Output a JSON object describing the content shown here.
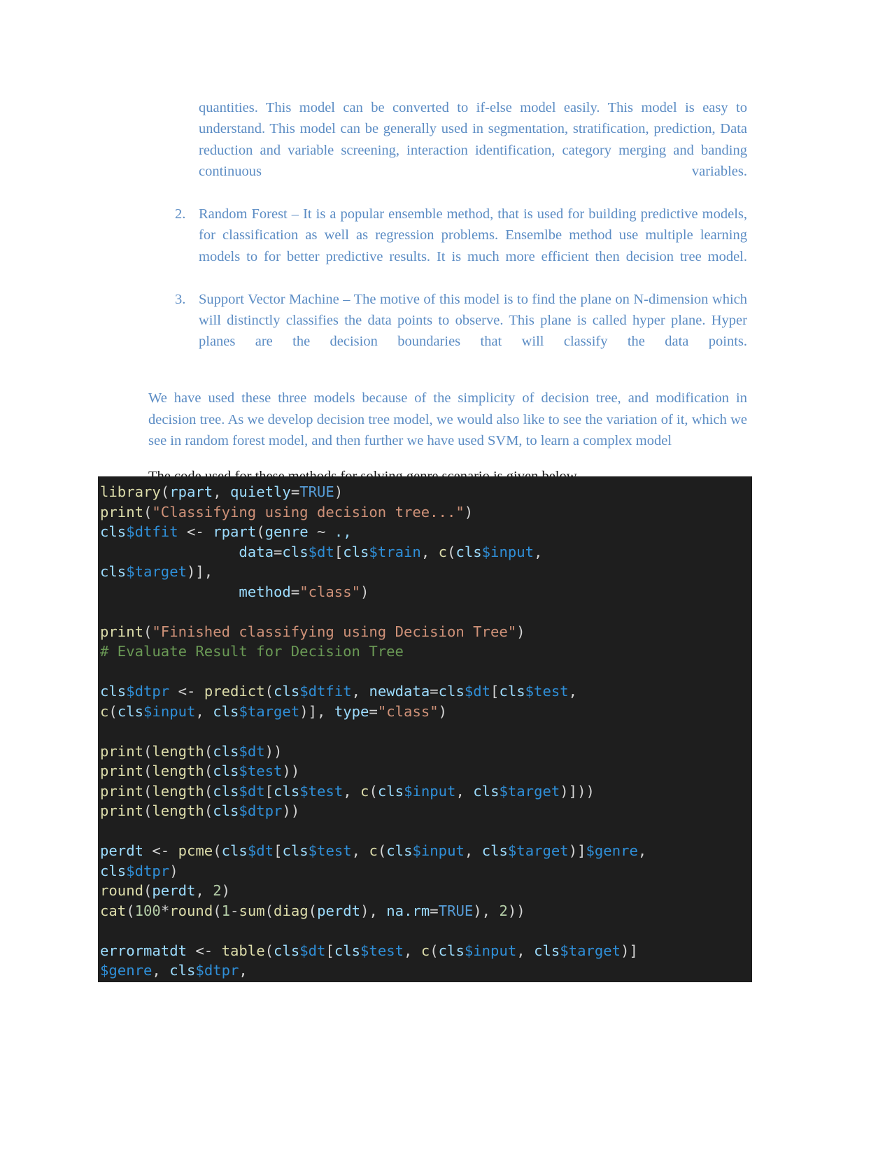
{
  "page": {
    "background": "#ffffff",
    "body_text_color": "#5b8cc4",
    "intro_text_color": "#161616"
  },
  "list": {
    "continued_paragraph": "quantities. This model can be converted to if-else model easily. This model is easy to understand. This model can be generally used in segmentation, stratification, prediction, Data reduction and variable screening, interaction identification, category merging and banding continuous variables.",
    "items": [
      {
        "number": "2.",
        "text": "Random Forest – It is a popular ensemble method, that is used for building predictive models, for classification as well as regression problems. Ensemlbe method use multiple learning models to for better predictive results. It is much more efficient then decision tree model."
      },
      {
        "number": "3.",
        "text": "Support Vector Machine – The motive of this model is to find the plane on N-dimension which will distinctly classifies the data points to observe. This plane is called hyper plane. Hyper planes are the decision boundaries that will classify the data points."
      }
    ]
  },
  "paragraph": "We have used these three models because of the simplicity of decision tree, and modification in decision tree. As we develop decision tree model, we would also like to see the variation of it, which we see in random forest model, and then further we have used SVM, to learn a complex model",
  "intro_line": "The code used for these methods for solving genre scenario is given below-",
  "code_block": {
    "background": "#1e1e1e",
    "language": "R",
    "colors": {
      "function": "#dcdcaa",
      "variable": "#9cdcfe",
      "accessor": "#2f8fd8",
      "string": "#ce9178",
      "keyword": "#569cd6",
      "number": "#b5cea8",
      "comment": "#6a9955",
      "default": "#d4d4d4"
    },
    "raw_text": "library(rpart, quietly=TRUE)\nprint(\"Classifying using decision tree...\")\ncls$dtfit <- rpart(genre ~ .,\n                data=cls$dt[cls$train, c(cls$input, cls$target)],\n                method=\"class\")\n\nprint(\"Finished classifying using Decision Tree\")\n# Evaluate Result for Decision Tree\n\ncls$dtpr <- predict(cls$dtfit, newdata=cls$dt[cls$test, c(cls$input, cls$target)], type=\"class\")\n\nprint(length(cls$dt))\nprint(length(cls$test))\nprint(length(cls$dt[cls$test, c(cls$input, cls$target)]))\nprint(length(cls$dtpr))\n\nperdt <- pcme(cls$dt[cls$test, c(cls$input, cls$target)]$genre, cls$dtpr)\nround(perdt, 2)\ncat(100*round(1-sum(diag(perdt), na.rm=TRUE), 2))\n\nerrormatdt <- table(cls$dt[cls$test, c(cls$input, cls$target)]$genre, cls$dtpr,",
    "lines": [
      "library(rpart, quietly=TRUE)",
      "print(\"Classifying using decision tree...\")",
      "cls$dtfit <- rpart(genre ~ .,",
      "                data=cls$dt[cls$train, c(cls$input,",
      "cls$target)],",
      "                method=\"class\")",
      "",
      "print(\"Finished classifying using Decision Tree\")",
      "# Evaluate Result for Decision Tree",
      "",
      "cls$dtpr <- predict(cls$dtfit, newdata=cls$dt[cls$test,",
      "c(cls$input, cls$target)], type=\"class\")",
      "",
      "print(length(cls$dt))",
      "print(length(cls$test))",
      "print(length(cls$dt[cls$test, c(cls$input, cls$target)]))",
      "print(length(cls$dtpr))",
      "",
      "perdt <- pcme(cls$dt[cls$test, c(cls$input, cls$target)]$genre,",
      "cls$dtpr)",
      "round(perdt, 2)",
      "cat(100*round(1-sum(diag(perdt), na.rm=TRUE), 2))",
      "",
      "errormatdt <- table(cls$dt[cls$test, c(cls$input, cls$target)]",
      "$genre, cls$dtpr,"
    ]
  }
}
